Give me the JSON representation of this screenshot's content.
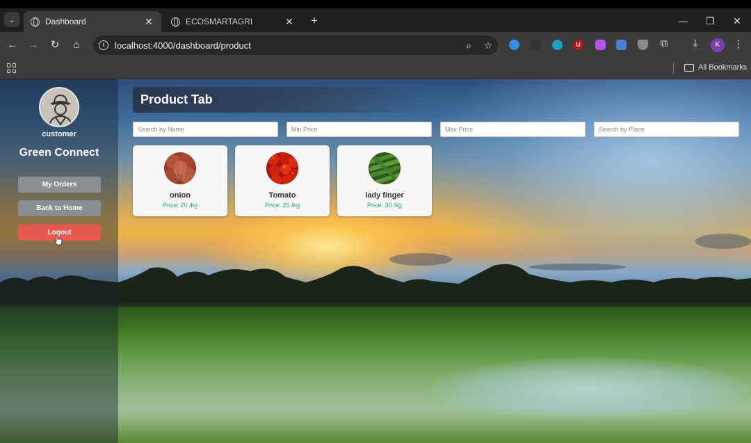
{
  "browser": {
    "tabs": [
      {
        "title": "Dashboard",
        "active": true
      },
      {
        "title": "ECOSMARTAGRI",
        "active": false
      }
    ],
    "address": "localhost:4000/dashboard/product",
    "profile_initial": "K",
    "bookmarks_label": "All Bookmarks",
    "extensions": [
      {
        "icon": "edge-icon",
        "color": "#2f8ee5"
      },
      {
        "icon": "dark-extension-icon",
        "color": "#333333"
      },
      {
        "icon": "refresh-extension-icon",
        "color": "#1aa3c4"
      },
      {
        "icon": "ublock-icon",
        "color": "#b5121b",
        "letter": "U"
      },
      {
        "icon": "purple-extension-icon",
        "color": "#b455e8"
      },
      {
        "icon": "image-extension-icon",
        "color": "#4a7fd6"
      },
      {
        "icon": "shield-extension-icon",
        "color": "#8a8a8a"
      }
    ]
  },
  "sidebar": {
    "role": "customer",
    "brand": "Green Connect",
    "buttons": {
      "orders": "My Orders",
      "home": "Back to Home",
      "logout": "Logout"
    }
  },
  "main": {
    "title": "Product Tab",
    "filters": {
      "name_placeholder": "Search by Name",
      "min_placeholder": "Min Price",
      "max_placeholder": "Max Price",
      "place_placeholder": "Search by Place"
    },
    "products": [
      {
        "name": "onion",
        "price": "Price: 20 /kg",
        "icon": "onion-image"
      },
      {
        "name": "Tomato",
        "price": "Price: 25 /kg",
        "icon": "tomato-image"
      },
      {
        "name": "lady finger",
        "price": "Price: 30 /kg",
        "icon": "lady-finger-image"
      }
    ]
  },
  "colors": {
    "logout": "#e85a50",
    "sidebar_button": "#8a8f94",
    "price": "#2ea37f"
  }
}
